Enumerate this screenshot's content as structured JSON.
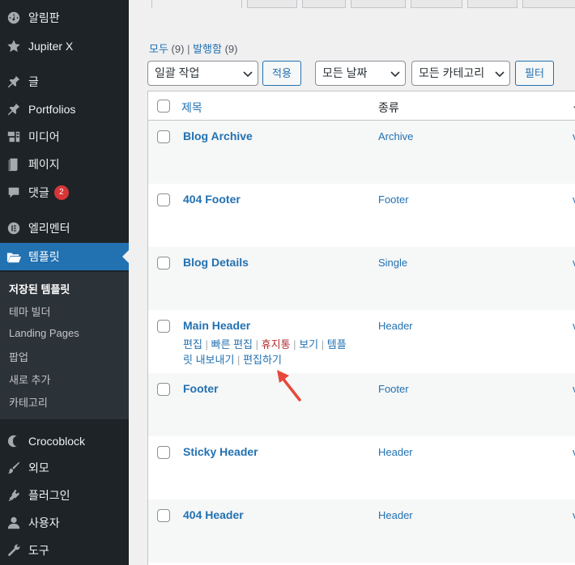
{
  "sidebar": {
    "items": [
      {
        "label": "알림판",
        "icon": "dashboard-icon"
      },
      {
        "label": "Jupiter X",
        "icon": "star-icon"
      },
      {
        "label": "글",
        "icon": "pin-icon"
      },
      {
        "label": "Portfolios",
        "icon": "pin-icon"
      },
      {
        "label": "미디어",
        "icon": "media-icon"
      },
      {
        "label": "페이지",
        "icon": "page-icon"
      },
      {
        "label": "댓글",
        "icon": "comment-icon",
        "badge": "2"
      },
      {
        "label": "엘리멘터",
        "icon": "elementor-icon"
      },
      {
        "label": "템플릿",
        "icon": "folder-icon",
        "active": true
      },
      {
        "label": "Crocoblock",
        "icon": "crocoblock-icon"
      },
      {
        "label": "외모",
        "icon": "brush-icon"
      },
      {
        "label": "플러그인",
        "icon": "plugin-icon"
      },
      {
        "label": "사용자",
        "icon": "user-icon"
      },
      {
        "label": "도구",
        "icon": "wrench-icon"
      }
    ],
    "submenu": [
      {
        "label": "저장된 템플릿",
        "current": true
      },
      {
        "label": "테마 빌더"
      },
      {
        "label": "Landing Pages"
      },
      {
        "label": "팝업"
      },
      {
        "label": "새로 추가"
      },
      {
        "label": "카테고리"
      }
    ]
  },
  "views": {
    "all_label": "모두",
    "all_count": "(9)",
    "published_label": "발행함",
    "published_count": "(9)",
    "separator": "|"
  },
  "filters": {
    "bulk_action": "일괄 작업",
    "apply": "적용",
    "date": "모든 날짜",
    "category": "모든 카테고리",
    "filter": "필터"
  },
  "table": {
    "columns": [
      "제목",
      "종류"
    ],
    "rows": [
      {
        "title": "Blog Archive",
        "type": "Archive",
        "trunc": "v"
      },
      {
        "title": "404 Footer",
        "type": "Footer",
        "trunc": "v"
      },
      {
        "title": "Blog Details",
        "type": "Single",
        "trunc": "v"
      },
      {
        "title": "Main Header",
        "type": "Header",
        "trunc": "v"
      },
      {
        "title": "Footer",
        "type": "Footer",
        "trunc": "v"
      },
      {
        "title": "Sticky Header",
        "type": "Header",
        "trunc": "v"
      },
      {
        "title": "404 Header",
        "type": "Header",
        "trunc": "v"
      }
    ],
    "row_actions": {
      "edit": "편집",
      "quick_edit": "빠른 편집",
      "trash": "휴지통",
      "view": "보기",
      "export_line1": "템플",
      "export_line2": "릿 내보내기",
      "edit_with": "편집하기",
      "separator": "|"
    }
  },
  "colors": {
    "sidebar_bg": "#1d2327",
    "accent": "#2271b1",
    "annotation_arrow": "#e8483a"
  }
}
